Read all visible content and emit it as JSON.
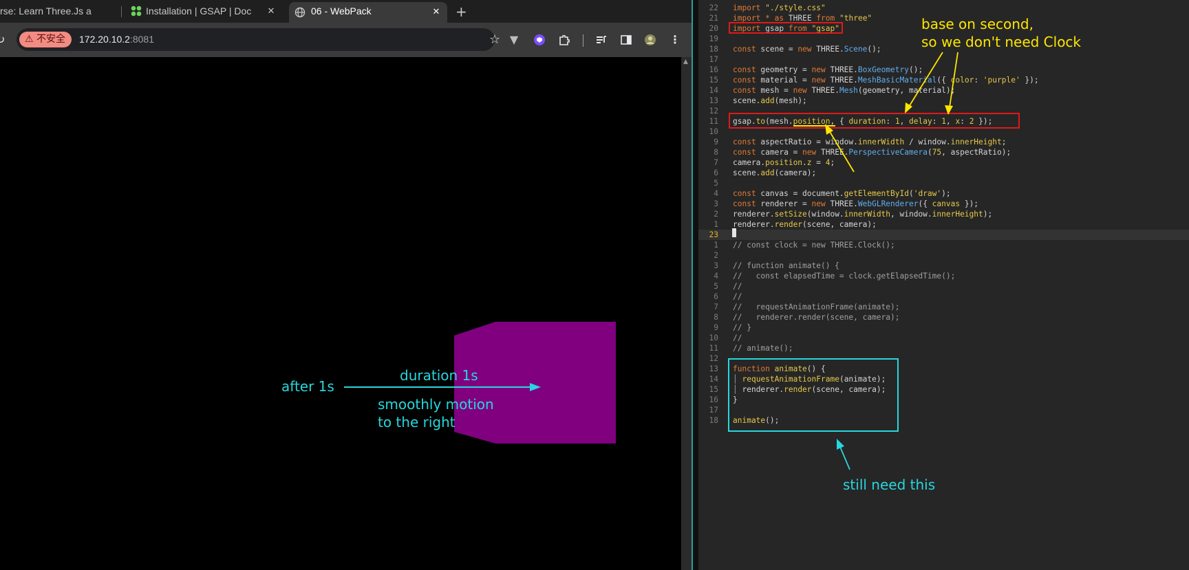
{
  "browser": {
    "tabs": [
      {
        "title": "rse: Learn Three.Js a",
        "active": false
      },
      {
        "title": "Installation | GSAP | Doc",
        "active": false
      },
      {
        "title": "06 - WebPack",
        "active": true
      }
    ],
    "close_glyph": "✕",
    "new_tab_glyph": "+",
    "insecure_label": "⚠ 不安全",
    "url_host": "172.20.10.2",
    "url_port": ":8081",
    "toolbar_icons": [
      "star-icon",
      "vue-devtools-icon",
      "shield-extension-icon",
      "puzzle-extensions-icon",
      "media-control-icon",
      "side-panel-icon",
      "profile-avatar-icon",
      "kebab-menu-icon"
    ],
    "cube_color": "#800080",
    "annotations": {
      "after": "after 1s",
      "duration": "duration 1s",
      "smooth_line1": "smoothly motion",
      "smooth_line2": "to the right"
    }
  },
  "editor": {
    "accent": "#2aa198",
    "annotations": {
      "yellow_line1": "base on second,",
      "yellow_line2": "so we don't need Clock",
      "still_need": "still need this"
    },
    "lines": [
      {
        "n": "22",
        "html": "<span class=\"kw\">import</span> <span class=\"str\">\"./style.css\"</span>"
      },
      {
        "n": "21",
        "html": "<span class=\"kw\">import</span> <span class=\"kw\">*</span> <span class=\"kw\">as</span> THREE <span class=\"kw\">from</span> <span class=\"str\">\"three\"</span>"
      },
      {
        "n": "20",
        "html": "<span class=\"kw\">import</span> gsap <span class=\"kw\">from</span> <span class=\"str\">\"gsap\"</span>"
      },
      {
        "n": "19",
        "html": ""
      },
      {
        "n": "18",
        "html": "<span class=\"kw\">const</span> scene = <span class=\"kw\">new</span> THREE.<span class=\"cls\">Scene</span>();"
      },
      {
        "n": "17",
        "html": ""
      },
      {
        "n": "16",
        "html": "<span class=\"kw\">const</span> geometry = <span class=\"kw\">new</span> THREE.<span class=\"cls\">BoxGeometry</span>();"
      },
      {
        "n": "15",
        "html": "<span class=\"kw\">const</span> material = <span class=\"kw\">new</span> THREE.<span class=\"cls\">MeshBasicMaterial</span>({ <span class=\"prop\">color</span>: <span class=\"str\">'purple'</span> });"
      },
      {
        "n": "14",
        "html": "<span class=\"kw\">const</span> mesh = <span class=\"kw\">new</span> THREE.<span class=\"cls\">Mesh</span>(geometry, material);"
      },
      {
        "n": "13",
        "html": "scene.<span class=\"fn\">add</span>(mesh);"
      },
      {
        "n": "12",
        "html": ""
      },
      {
        "n": "11",
        "html": "gsap.<span class=\"fn\">to</span>(mesh.<span class=\"prop\">position</span>, { <span class=\"prop\">duration</span>: <span class=\"num\">1</span>, <span class=\"prop\">delay</span>: <span class=\"num\">1</span>, <span class=\"prop\">x</span>: <span class=\"num\">2</span> });"
      },
      {
        "n": "10",
        "html": ""
      },
      {
        "n": "9",
        "html": "<span class=\"kw\">const</span> aspectRatio = window.<span class=\"prop\">innerWidth</span> / window.<span class=\"prop\">innerHeight</span>;"
      },
      {
        "n": "8",
        "html": "<span class=\"kw\">const</span> camera = <span class=\"kw\">new</span> THREE.<span class=\"cls\">PerspectiveCamera</span>(<span class=\"num\">75</span>, aspectRatio);"
      },
      {
        "n": "7",
        "html": "camera.<span class=\"prop\">position</span>.<span class=\"prop\">z</span> = <span class=\"num\">4</span>;"
      },
      {
        "n": "6",
        "html": "scene.<span class=\"fn\">add</span>(camera);"
      },
      {
        "n": "5",
        "html": ""
      },
      {
        "n": "4",
        "html": "<span class=\"kw\">const</span> canvas = document.<span class=\"fn\">getElementById</span>(<span class=\"str\">'draw'</span>);"
      },
      {
        "n": "3",
        "html": "<span class=\"kw\">const</span> renderer = <span class=\"kw\">new</span> THREE.<span class=\"cls\">WebGLRenderer</span>({ <span class=\"prop\">canvas</span> });"
      },
      {
        "n": "2",
        "html": "renderer.<span class=\"fn\">setSize</span>(window.<span class=\"prop\">innerWidth</span>, window.<span class=\"prop\">innerHeight</span>);"
      },
      {
        "n": "1",
        "html": "renderer.<span class=\"fn\">render</span>(scene, camera);"
      },
      {
        "n": "23",
        "html": "",
        "current": true
      },
      {
        "n": "1",
        "html": "<span class=\"cm\">// const clock = new THREE.Clock();</span>"
      },
      {
        "n": "2",
        "html": ""
      },
      {
        "n": "3",
        "html": "<span class=\"cm\">// function animate() {</span>"
      },
      {
        "n": "4",
        "html": "<span class=\"cm\">//   const elapsedTime = clock.getElapsedTime();</span>"
      },
      {
        "n": "5",
        "html": "<span class=\"cm\">//</span>"
      },
      {
        "n": "6",
        "html": "<span class=\"cm\">//</span>"
      },
      {
        "n": "7",
        "html": "<span class=\"cm\">//   requestAnimationFrame(animate);</span>"
      },
      {
        "n": "8",
        "html": "<span class=\"cm\">//   renderer.render(scene, camera);</span>"
      },
      {
        "n": "9",
        "html": "<span class=\"cm\">// }</span>"
      },
      {
        "n": "10",
        "html": "<span class=\"cm\">//</span>"
      },
      {
        "n": "11",
        "html": "<span class=\"cm\">// animate();</span>"
      },
      {
        "n": "12",
        "html": ""
      },
      {
        "n": "13",
        "html": "<span class=\"kw\">function</span> <span class=\"fn\">animate</span>() {"
      },
      {
        "n": "14",
        "html": "<span class=\"cm\">│</span> <span class=\"fn\">requestAnimationFrame</span>(animate);"
      },
      {
        "n": "15",
        "html": "<span class=\"cm\">│</span> renderer.<span class=\"fn\">render</span>(scene, camera);"
      },
      {
        "n": "16",
        "html": "}"
      },
      {
        "n": "17",
        "html": ""
      },
      {
        "n": "18",
        "html": "<span class=\"fn\">animate</span>();"
      }
    ]
  }
}
